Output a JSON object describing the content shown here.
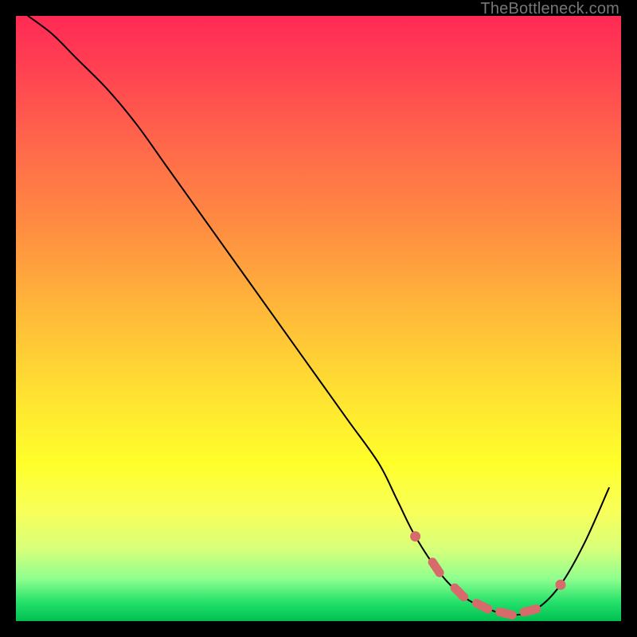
{
  "watermark": {
    "text": "TheBottleneck.com"
  },
  "chart_data": {
    "type": "line",
    "title": "",
    "xlabel": "",
    "ylabel": "",
    "xlim": [
      0,
      100
    ],
    "ylim": [
      0,
      100
    ],
    "grid": false,
    "legend": false,
    "series": [
      {
        "name": "bottleneck-curve",
        "x": [
          2,
          6,
          10,
          15,
          20,
          25,
          30,
          35,
          40,
          45,
          50,
          55,
          60,
          63,
          66,
          70,
          74,
          78,
          82,
          86,
          90,
          94,
          98
        ],
        "y": [
          100,
          97,
          93,
          88,
          82,
          75,
          68,
          61,
          54,
          47,
          40,
          33,
          26,
          20,
          14,
          8,
          4,
          2,
          1,
          2,
          6,
          13,
          22
        ]
      }
    ],
    "highlight_zone": {
      "name": "optimal-range",
      "x": [
        66,
        70,
        74,
        78,
        82,
        86,
        90
      ],
      "y": [
        14,
        8,
        4,
        2,
        1,
        2,
        6
      ],
      "color": "#d76a6a"
    },
    "background_gradient": {
      "top": "#ff2a55",
      "mid": "#ffe032",
      "bottom": "#00c050"
    }
  }
}
